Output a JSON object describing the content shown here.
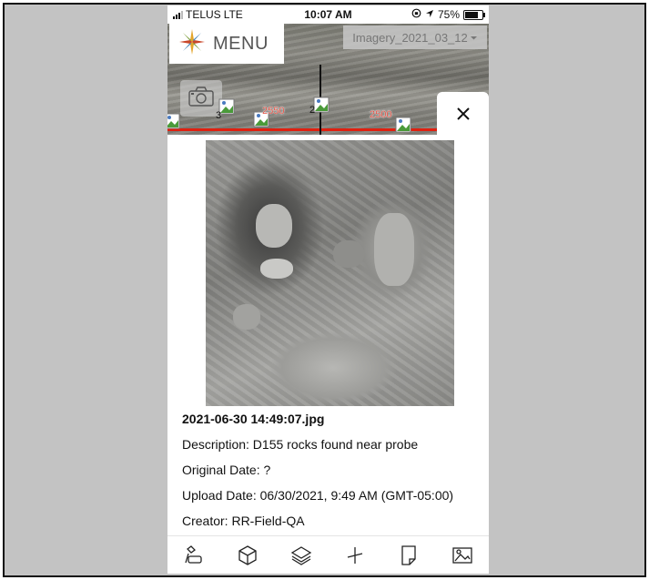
{
  "status_bar": {
    "carrier": "TELUS",
    "network": "LTE",
    "time": "10:07 AM",
    "battery": "75%",
    "battery_level": 0.75
  },
  "map": {
    "menu_label": "MENU",
    "imagery_select": "Imagery_2021_03_12",
    "markers": [
      "3",
      "2"
    ],
    "distance_labels": [
      "2550",
      "2500"
    ]
  },
  "photo_panel": {
    "filename": "2021-06-30 14:49:07.jpg",
    "description": "Description: D155 rocks found near probe",
    "original_date": "Original Date: ?",
    "upload_date": "Upload Date: 06/30/2021, 9:49 AM (GMT-05:00)",
    "creator": "Creator: RR-Field-QA"
  },
  "toolbar": {
    "icons": [
      "measure-icon",
      "cube-icon",
      "layers-icon",
      "crosshair-icon",
      "page-icon",
      "image-icon"
    ]
  },
  "colors": {
    "route_line": "#e02010",
    "distance_label": "#d21"
  }
}
